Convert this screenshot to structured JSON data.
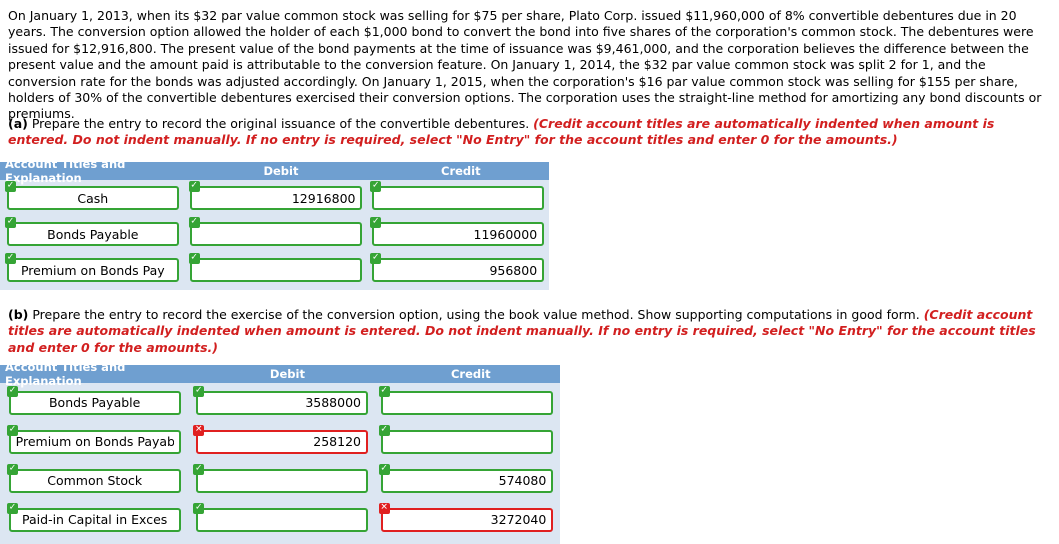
{
  "problem": {
    "text": "On January 1, 2013, when its $32 par value common stock was selling for $75 per share, Plato Corp. issued $11,960,000 of 8% convertible debentures due in 20 years. The conversion option allowed the holder of each $1,000 bond to convert the bond into five shares of the corporation's common stock. The debentures were issued for $12,916,800. The present value of the bond payments at the time of issuance was $9,461,000, and the corporation believes the difference between the present value and the amount paid is attributable to the conversion feature. On January 1, 2014, the $32 par value common stock was split 2 for 1, and the conversion rate for the bonds was adjusted accordingly. On January 1, 2015, when the corporation's $16 par value common stock was selling for $155 per share, holders of 30% of the convertible debentures exercised their conversion options. The corporation uses the straight-line method for amortizing any bond discounts or premiums."
  },
  "part_a": {
    "label": "(a)",
    "prompt": "Prepare the entry to record the original issuance of the convertible debentures.",
    "instruction": "(Credit account titles are automatically indented when amount is entered. Do not indent manually. If no entry is required, select \"No Entry\" for the account titles and enter 0 for the amounts.)",
    "columns": {
      "account": "Account Titles and Explanation",
      "debit": "Debit",
      "credit": "Credit"
    },
    "rows": [
      {
        "account": "Cash",
        "account_status": "ok",
        "debit": "12916800",
        "debit_status": "ok",
        "credit": "",
        "credit_status": "ok"
      },
      {
        "account": "Bonds Payable",
        "account_status": "ok",
        "debit": "",
        "debit_status": "ok",
        "credit": "11960000",
        "credit_status": "ok"
      },
      {
        "account": "Premium on Bonds Pay",
        "account_status": "ok",
        "debit": "",
        "debit_status": "ok",
        "credit": "956800",
        "credit_status": "ok"
      }
    ]
  },
  "part_b": {
    "label": "(b)",
    "prompt": "Prepare the entry to record the exercise of the conversion option, using the book value method. Show supporting computations in good form.",
    "instruction": "(Credit account titles are automatically indented when amount is entered. Do not indent manually. If no entry is required, select \"No Entry\" for the account titles and enter 0 for the amounts.)",
    "columns": {
      "account": "Account Titles and Explanation",
      "debit": "Debit",
      "credit": "Credit"
    },
    "rows": [
      {
        "account": "Bonds Payable",
        "account_status": "ok",
        "debit": "3588000",
        "debit_status": "ok",
        "credit": "",
        "credit_status": "ok"
      },
      {
        "account": "Premium on Bonds Payable",
        "account_status": "ok",
        "debit": "258120",
        "debit_status": "bad",
        "credit": "",
        "credit_status": "ok"
      },
      {
        "account": "Common Stock",
        "account_status": "ok",
        "debit": "",
        "debit_status": "ok",
        "credit": "574080",
        "credit_status": "ok"
      },
      {
        "account": "Paid-in Capital in Exces",
        "account_status": "ok",
        "debit": "",
        "debit_status": "ok",
        "credit": "3272040",
        "credit_status": "bad"
      }
    ]
  },
  "icons": {
    "ok": "✓",
    "bad": "✕"
  },
  "colors": {
    "header_bar": "#6f9fd0",
    "table_bg": "#dce6f2",
    "valid_border": "#35a435",
    "error_border": "#e02020",
    "instruction_red": "#d21f1f"
  }
}
